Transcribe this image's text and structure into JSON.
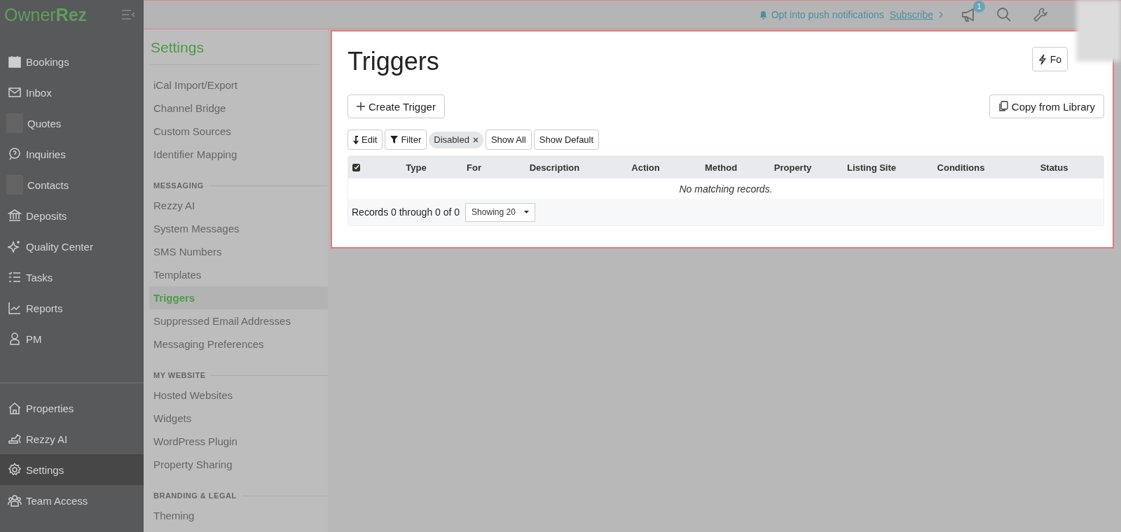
{
  "brand": {
    "light": "Owner",
    "bold": "Rez"
  },
  "sidebar": {
    "main": [
      {
        "label": "Bookings",
        "selected": false
      },
      {
        "label": "Inbox",
        "selected": false
      },
      {
        "label": "Quotes",
        "selected": false
      },
      {
        "label": "Inquiries",
        "selected": false
      },
      {
        "label": "Contacts",
        "selected": false
      },
      {
        "label": "Deposits",
        "selected": false
      },
      {
        "label": "Quality Center",
        "selected": false
      },
      {
        "label": "Tasks",
        "selected": false
      },
      {
        "label": "Reports",
        "selected": false
      },
      {
        "label": "PM",
        "selected": false
      }
    ],
    "bottom": [
      {
        "label": "Properties",
        "selected": false
      },
      {
        "label": "Rezzy AI",
        "selected": false
      },
      {
        "label": "Settings",
        "selected": true
      },
      {
        "label": "Team Access",
        "selected": false
      }
    ]
  },
  "topbar": {
    "notice": "Opt into push notifications",
    "link": "Subscribe",
    "badge": "1"
  },
  "settings_nav": {
    "title": "Settings",
    "sections": [
      {
        "items": [
          {
            "label": "iCal Import/Export",
            "selected": false
          },
          {
            "label": "Channel Bridge",
            "selected": false
          },
          {
            "label": "Custom Sources",
            "selected": false
          },
          {
            "label": "Identifier Mapping",
            "selected": false
          }
        ]
      },
      {
        "heading": "MESSAGING",
        "items": [
          {
            "label": "Rezzy AI",
            "selected": false
          },
          {
            "label": "System Messages",
            "selected": false
          },
          {
            "label": "SMS Numbers",
            "selected": false
          },
          {
            "label": "Templates",
            "selected": false
          },
          {
            "label": "Triggers",
            "selected": true
          },
          {
            "label": "Suppressed Email Addresses",
            "selected": false
          },
          {
            "label": "Messaging Preferences",
            "selected": false
          }
        ]
      },
      {
        "heading": "MY WEBSITE",
        "items": [
          {
            "label": "Hosted Websites",
            "selected": false
          },
          {
            "label": "Widgets",
            "selected": false
          },
          {
            "label": "WordPress Plugin",
            "selected": false
          },
          {
            "label": "Property Sharing",
            "selected": false
          }
        ]
      },
      {
        "heading": "BRANDING & LEGAL",
        "items": [
          {
            "label": "Theming",
            "selected": false
          }
        ]
      }
    ]
  },
  "page": {
    "title": "Triggers",
    "forecast_button": "Fo",
    "create_button": "Create Trigger",
    "copy_button": "Copy from Library",
    "toolbar": [
      {
        "label": "Edit",
        "kind": "edit"
      },
      {
        "label": "Filter",
        "kind": "filter"
      },
      {
        "label": "Disabled",
        "kind": "chip"
      },
      {
        "label": "Show All",
        "kind": "plain"
      },
      {
        "label": "Show Default",
        "kind": "plain"
      }
    ],
    "table": {
      "select_all_checked": true,
      "columns": [
        "Type",
        "For",
        "Description",
        "Action",
        "Method",
        "Property",
        "Listing Site",
        "Conditions",
        "Status"
      ],
      "empty": "No matching records.",
      "footer": "Records 0 through 0 of 0",
      "page_size": "Showing 20"
    }
  }
}
